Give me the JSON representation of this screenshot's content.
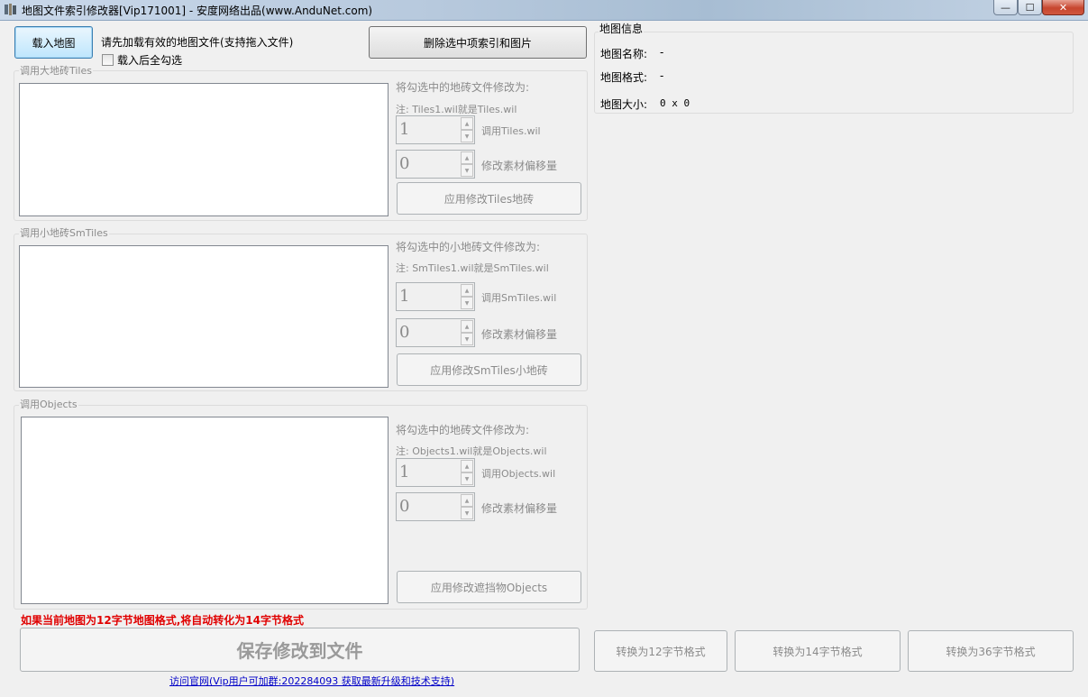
{
  "window": {
    "title": "地图文件索引修改器[Vip171001] - 安度网络出品(www.AnduNet.com)",
    "controls": {
      "minimize": "—",
      "maximize": "☐",
      "close": "✕"
    }
  },
  "toolbar": {
    "load_map": "载入地图",
    "hint": "请先加载有效的地图文件(支持拖入文件)",
    "select_all_after_load": "载入后全勾选",
    "delete_selected": "删除选中项索引和图片"
  },
  "tiles": {
    "legend": "调用大地砖Tiles",
    "modify_label": "将勾选中的地砖文件修改为:",
    "note": "注: Tiles1.wil就是Tiles.wil",
    "index_value": "1",
    "index_label": "调用Tiles.wil",
    "offset_value": "0",
    "offset_label": "修改素材偏移量",
    "apply": "应用修改Tiles地砖"
  },
  "smtiles": {
    "legend": "调用小地砖SmTiles",
    "modify_label": "将勾选中的小地砖文件修改为:",
    "note": "注: SmTiles1.wil就是SmTiles.wil",
    "index_value": "1",
    "index_label": "调用SmTiles.wil",
    "offset_value": "0",
    "offset_label": "修改素材偏移量",
    "apply": "应用修改SmTiles小地砖"
  },
  "objects": {
    "legend": "调用Objects",
    "modify_label": "将勾选中的地砖文件修改为:",
    "note": "注: Objects1.wil就是Objects.wil",
    "index_value": "1",
    "index_label": "调用Objects.wil",
    "offset_value": "0",
    "offset_label": "修改素材偏移量",
    "apply": "应用修改遮挡物Objects"
  },
  "map_info": {
    "legend": "地图信息",
    "name_label": "地图名称:",
    "name_value": "-",
    "format_label": "地图格式:",
    "format_value": "-",
    "size_label": "地图大小:",
    "size_value": "0 x 0"
  },
  "footer": {
    "warning": "如果当前地图为12字节地图格式,将自动转化为14字节格式",
    "save": "保存修改到文件",
    "convert12": "转换为12字节格式",
    "convert14": "转换为14字节格式",
    "convert36": "转换为36字节格式",
    "link": "访问官网(Vip用户可加群:202284093 获取最新升级和技术支持)"
  },
  "colors": {
    "warning": "#e00000",
    "link": "#0000c8",
    "disabled_text": "#8b8b8b",
    "focus_button": "#bee6fd"
  }
}
